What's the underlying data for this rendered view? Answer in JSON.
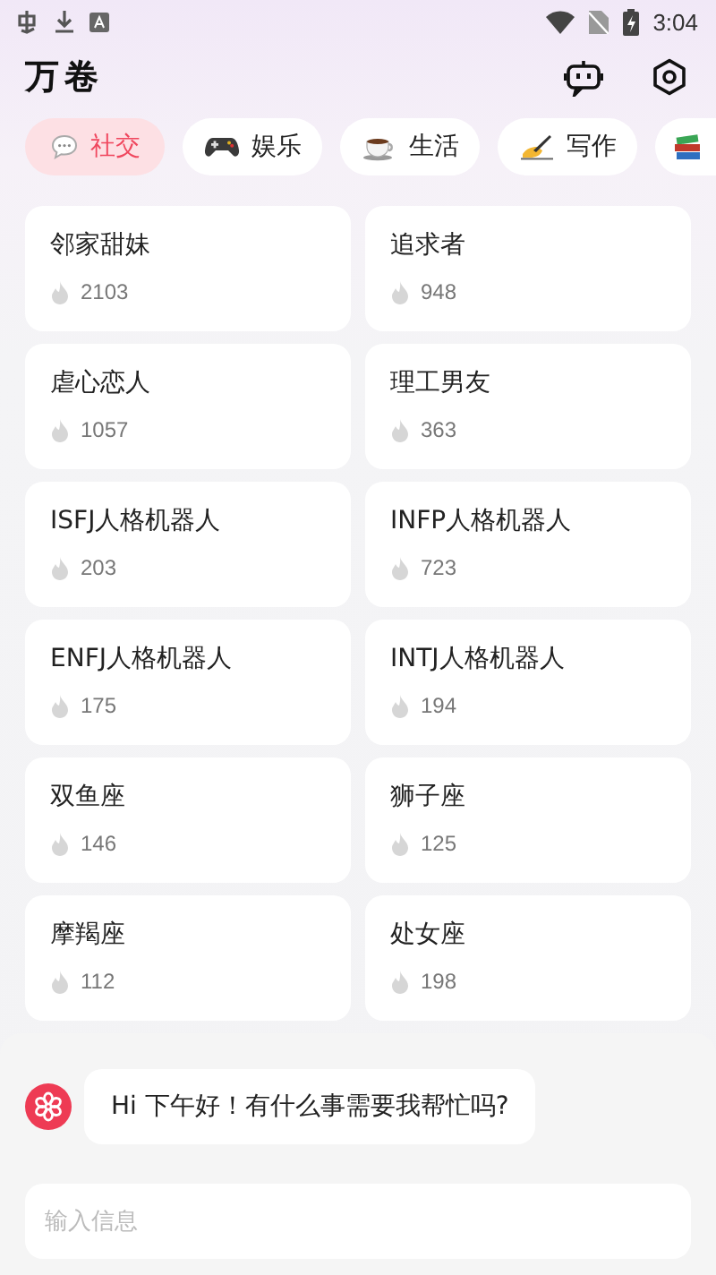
{
  "status_bar": {
    "time": "3:04"
  },
  "header": {
    "title": "万卷"
  },
  "tabs": [
    {
      "kind": "speech",
      "label": "社交",
      "selected": true
    },
    {
      "kind": "gamepad",
      "label": "娱乐",
      "selected": false
    },
    {
      "kind": "coffee",
      "label": "生活",
      "selected": false
    },
    {
      "kind": "pen",
      "label": "写作",
      "selected": false
    },
    {
      "kind": "books",
      "selected": false
    }
  ],
  "cards": [
    {
      "name": "邻家甜妹",
      "count": "2103"
    },
    {
      "name": "追求者",
      "count": "948"
    },
    {
      "name": "虐心恋人",
      "count": "1057"
    },
    {
      "name": "理工男友",
      "count": "363"
    },
    {
      "name": "ISFJ人格机器人",
      "count": "203"
    },
    {
      "name": "INFP人格机器人",
      "count": "723"
    },
    {
      "name": "ENFJ人格机器人",
      "count": "175"
    },
    {
      "name": "INTJ人格机器人",
      "count": "194"
    },
    {
      "name": "双鱼座",
      "count": "146"
    },
    {
      "name": "狮子座",
      "count": "125"
    },
    {
      "name": "摩羯座",
      "count": "112"
    },
    {
      "name": "处女座",
      "count": "198"
    }
  ],
  "chat": {
    "message": "Hi 下午好！有什么事需要我帮忙吗?",
    "input": {
      "placeholder": "输入信息"
    }
  }
}
